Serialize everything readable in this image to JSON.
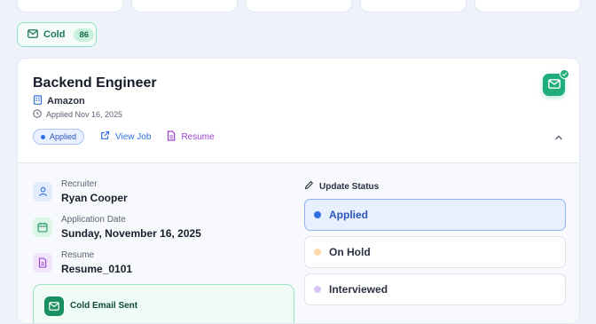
{
  "filter_chip": {
    "label": "Cold",
    "count": "86"
  },
  "job": {
    "title": "Backend Engineer",
    "company": "Amazon",
    "applied_on": "Applied Nov 16, 2025",
    "status_badge": "Applied",
    "view_job_label": "View Job",
    "resume_label": "Resume"
  },
  "details": {
    "recruiter_label": "Recruiter",
    "recruiter_value": "Ryan Cooper",
    "date_label": "Application Date",
    "date_value": "Sunday, November 16, 2025",
    "resume_label": "Resume",
    "resume_value": "Resume_0101",
    "cold_email_label": "Cold Email Sent"
  },
  "update_status": {
    "title": "Update Status",
    "options": [
      {
        "label": "Applied",
        "color": "#2f6fe0",
        "selected": true
      },
      {
        "label": "On Hold",
        "color": "#fcd9a8",
        "selected": false
      },
      {
        "label": "Interviewed",
        "color": "#d9c3f3",
        "selected": false
      }
    ]
  },
  "colors": {
    "accent_green": "#1fae7a",
    "accent_blue": "#2f6fe0",
    "accent_purple": "#9b3fd4"
  }
}
